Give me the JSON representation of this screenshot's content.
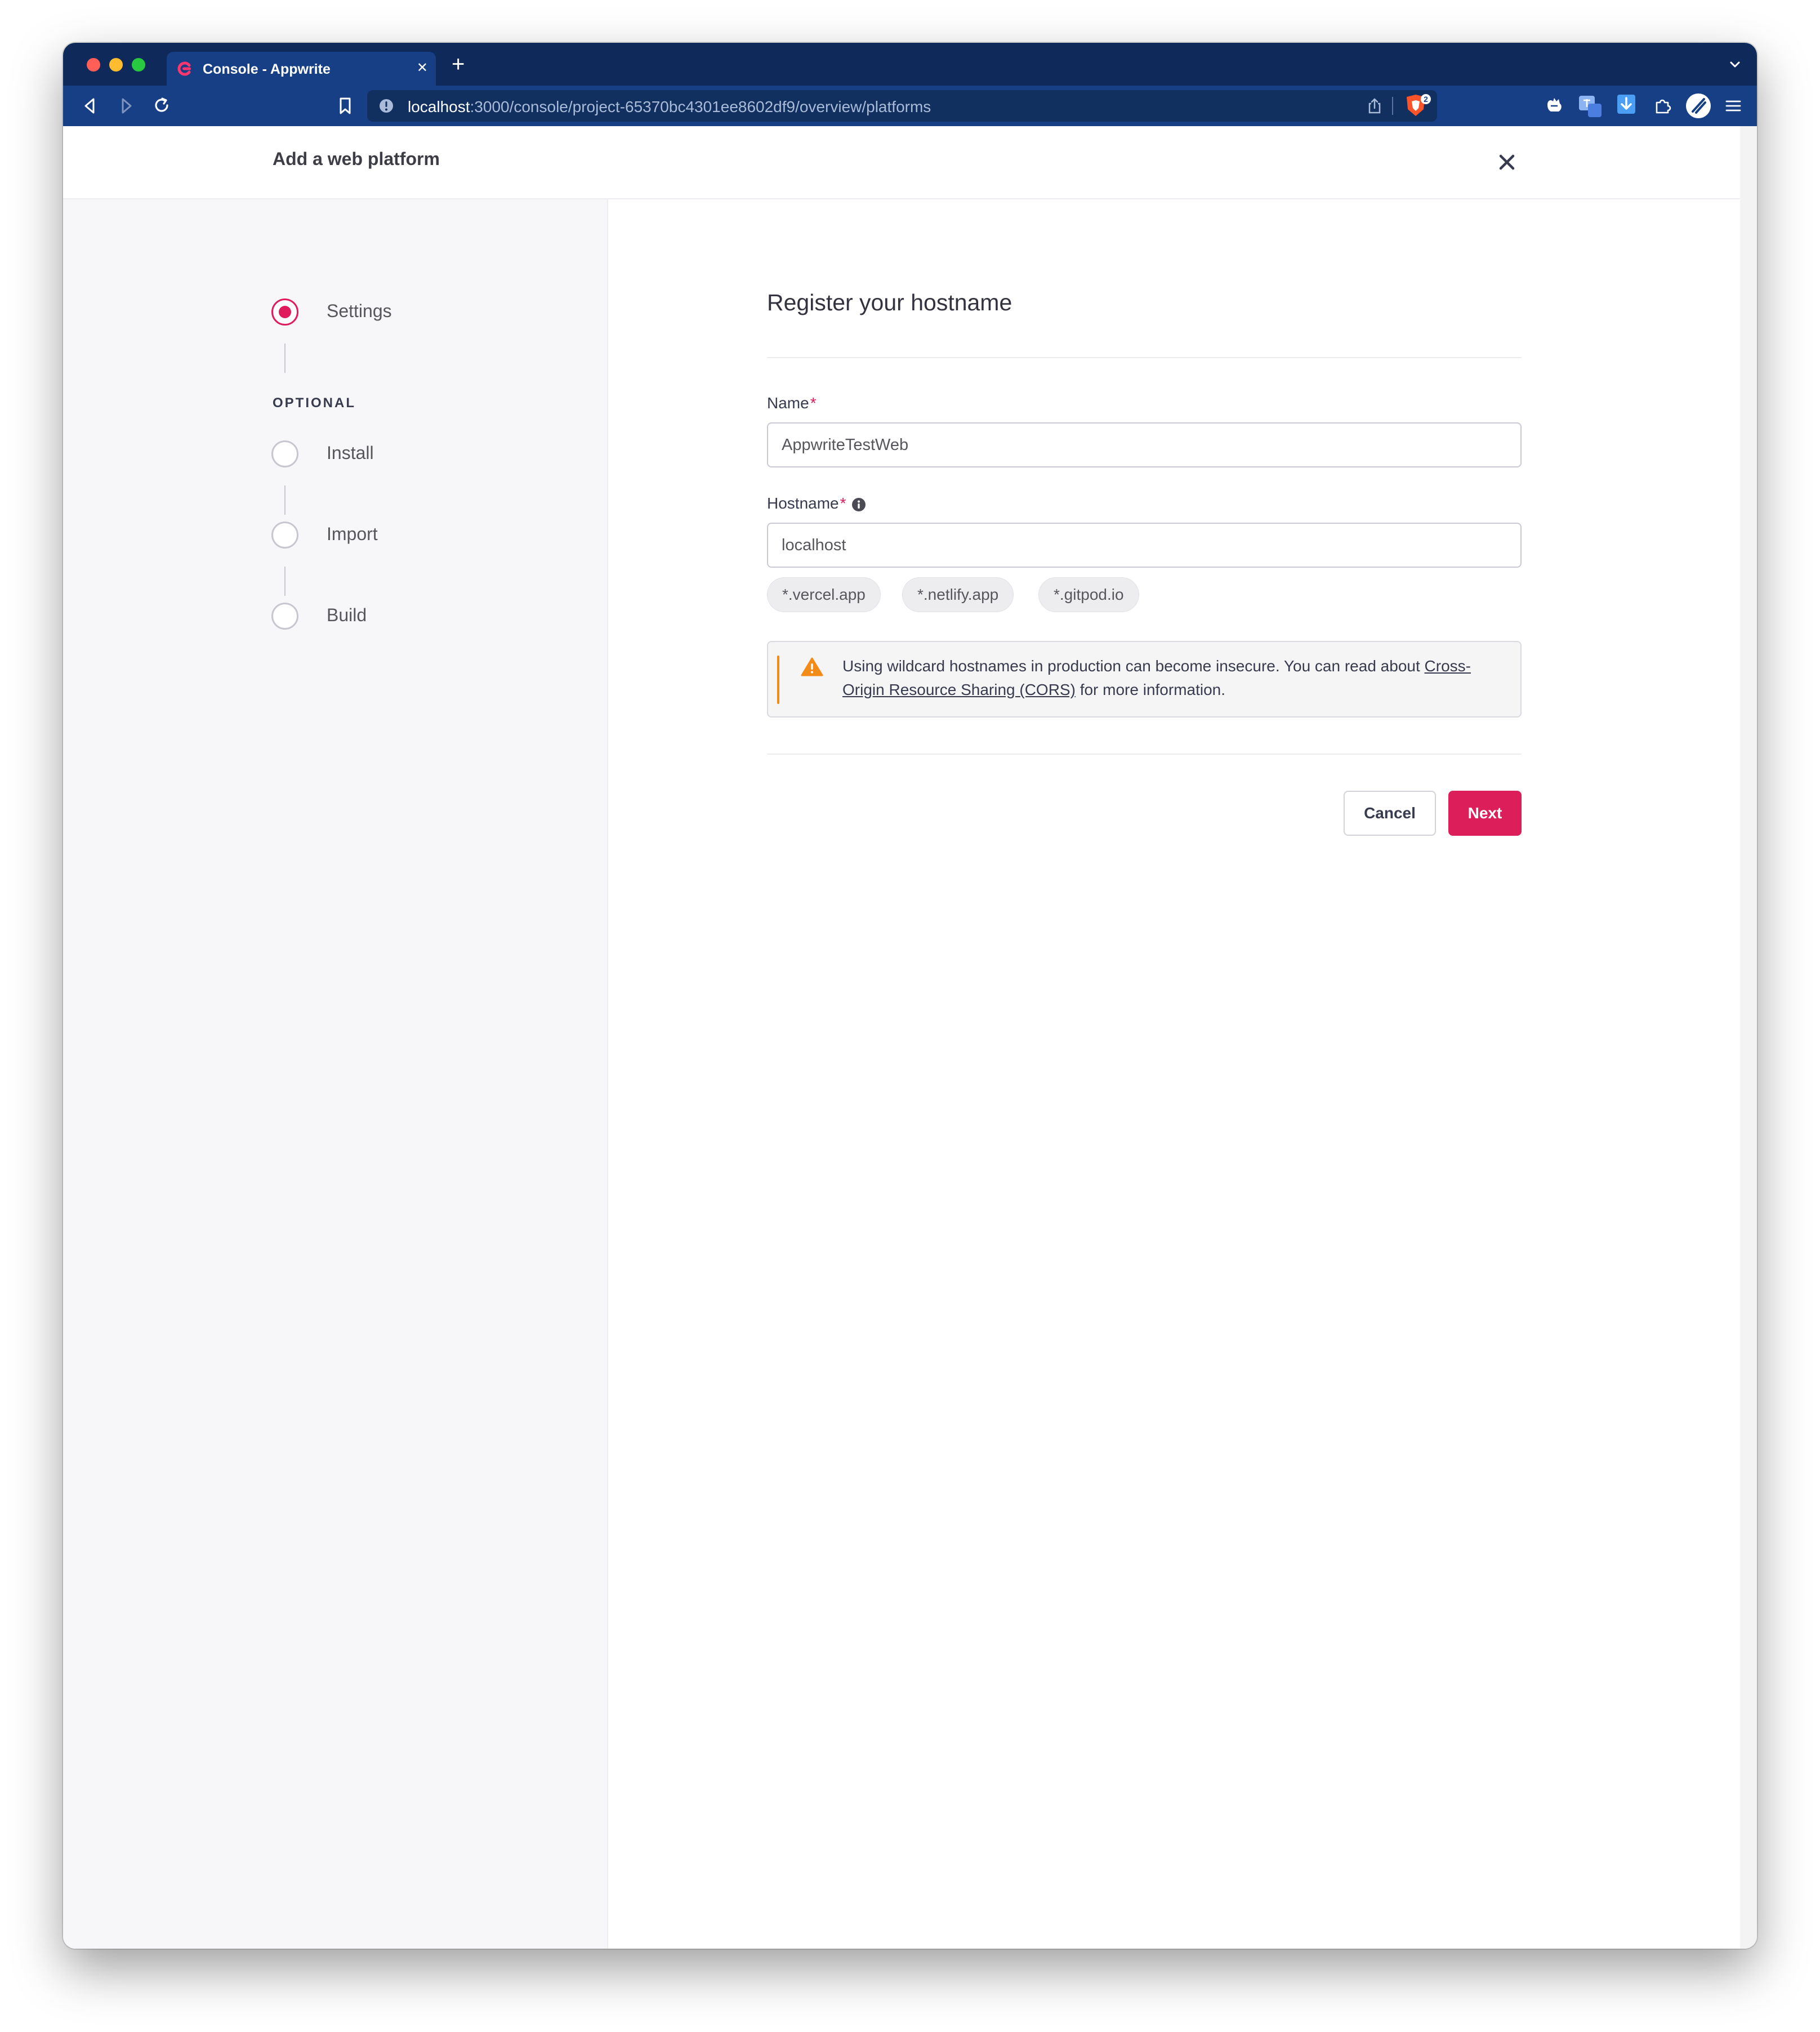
{
  "browser": {
    "tab_title": "Console - Appwrite",
    "url_host": "localhost",
    "url_path": ":3000/console/project-65370bc4301ee8602df9/overview/platforms",
    "brave_badge_count": "2"
  },
  "header": {
    "title": "Add a web platform"
  },
  "steps": {
    "settings": "Settings",
    "optional_label": "OPTIONAL",
    "install": "Install",
    "import": "Import",
    "build": "Build"
  },
  "form": {
    "title": "Register your hostname",
    "name_label": "Name",
    "name_value": "AppwriteTestWeb",
    "hostname_label": "Hostname",
    "hostname_value": "localhost",
    "required_mark": "*",
    "suggestions": [
      "*.vercel.app",
      "*.netlify.app",
      "*.gitpod.io"
    ]
  },
  "alert": {
    "text_before": "Using wildcard hostnames in production can become insecure. You can read about ",
    "link": "Cross-Origin Resource Sharing (CORS)",
    "text_after": " for more information."
  },
  "buttons": {
    "cancel": "Cancel",
    "next": "Next"
  },
  "colors": {
    "accent": "#dc1e5b",
    "warning": "#f28b17",
    "browser_chrome": "#173f86"
  }
}
